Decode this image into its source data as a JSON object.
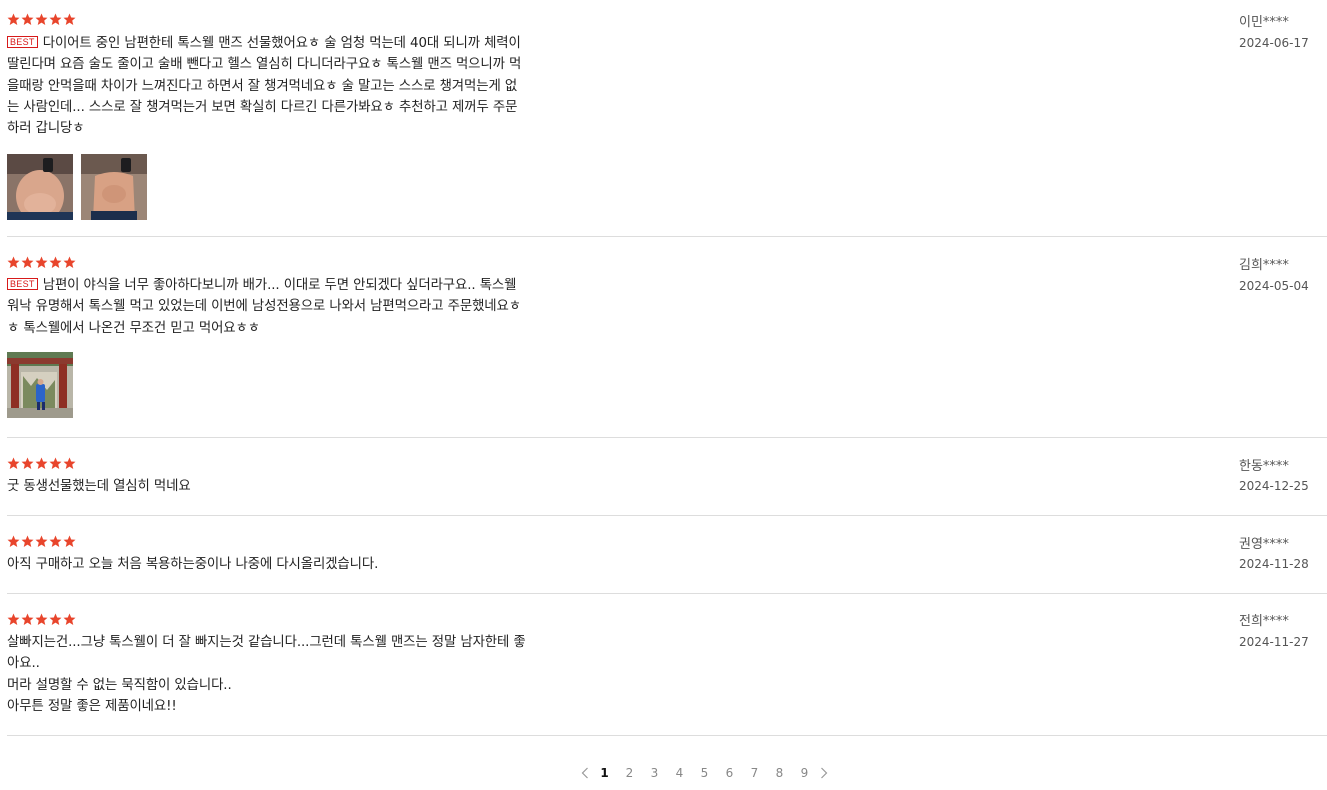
{
  "colors": {
    "star": "#e8452c",
    "best_badge": "#d71a1a",
    "divider": "#dddddd",
    "meta_text": "#555555"
  },
  "star_icon": "star-icon",
  "reviews": [
    {
      "rating": 5,
      "best_label": "BEST",
      "lines": [
        "다이어트 중인 남편한테 톡스웰 맨즈 선물했어요ㅎ 술 엄청 먹는데 40대 되니까 체력이",
        "딸린다며 요즘 술도 줄이고 술배 뺀다고 헬스 열심히 다니더라구요ㅎ 톡스웰 맨즈 먹으니까 먹",
        "을때랑 안먹을때 차이가 느껴진다고 하면서 잘 챙겨먹네요ㅎ 술 말고는 스스로 챙겨먹는게 없",
        "는 사람인데... 스스로 잘 챙겨먹는거 보면 확실히 다르긴 다른가봐요ㅎ 추천하고 제꺼두 주문",
        "하러 갑니당ㅎ"
      ],
      "author": "이민****",
      "date": "2024-06-17",
      "photos": [
        "photo-before-diet",
        "photo-after-diet"
      ]
    },
    {
      "rating": 5,
      "best_label": "BEST",
      "lines": [
        "남편이 야식을 너무 좋아하다보니까 배가... 이대로 두면 안되겠다 싶더라구요.. 톡스웰",
        "워낙 유명해서 톡스웰 먹고 있었는데 이번에 남성전용으로 나와서 남편먹으라고 주문했네요ㅎ",
        "ㅎ 톡스웰에서 나온건 무조건 믿고 먹어요ㅎㅎ"
      ],
      "author": "김희****",
      "date": "2024-05-04",
      "photos": [
        "photo-temple-gate"
      ]
    },
    {
      "rating": 5,
      "lines": [
        "굿 동생선물했는데 열심히 먹네요"
      ],
      "author": "한동****",
      "date": "2024-12-25",
      "photos": []
    },
    {
      "rating": 5,
      "lines": [
        "아직 구매하고 오늘 처음 복용하는중이나 나중에 다시올리겠습니다."
      ],
      "author": "권영****",
      "date": "2024-11-28",
      "photos": []
    },
    {
      "rating": 5,
      "lines": [
        "살빠지는건...그냥 톡스웰이 더 잘 빠지는것 같습니다...그런데 톡스웰 맨즈는 정말 남자한테 좋",
        "아요..",
        "머라 설명할 수 없는 묵직함이 있습니다..",
        "아무튼 정말 좋은 제품이네요!!"
      ],
      "author": "전희****",
      "date": "2024-11-27",
      "photos": []
    }
  ],
  "pagination": {
    "prev_icon": "chevron-left-icon",
    "next_icon": "chevron-right-icon",
    "pages": [
      "1",
      "2",
      "3",
      "4",
      "5",
      "6",
      "7",
      "8",
      "9"
    ],
    "current": "1"
  }
}
